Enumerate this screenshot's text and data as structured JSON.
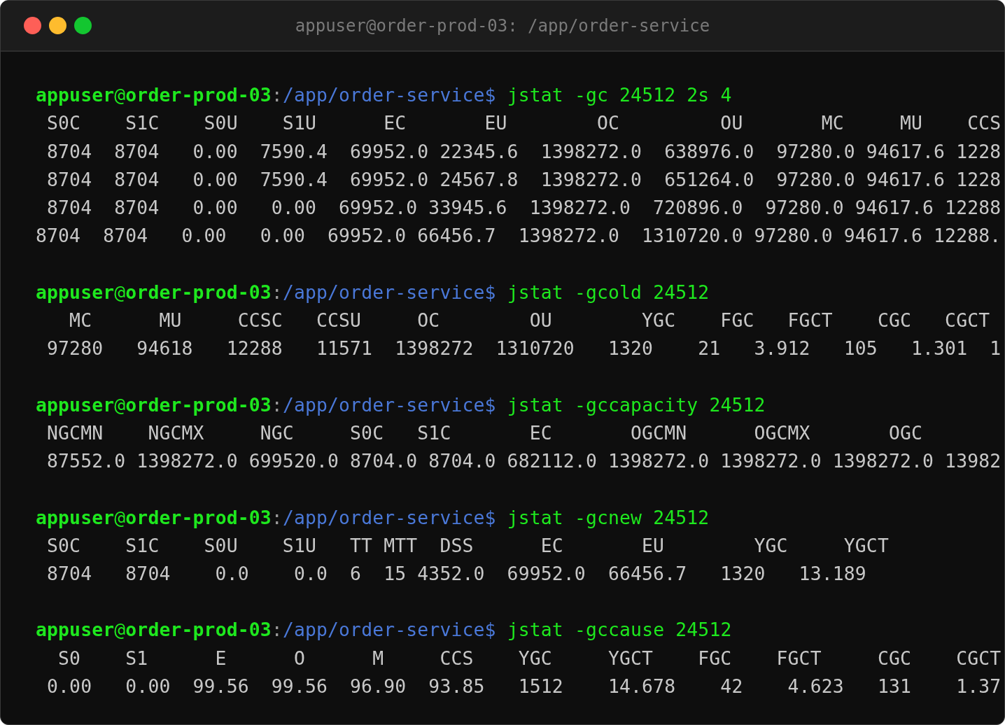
{
  "window": {
    "title": "appuser@order-prod-03: /app/order-service"
  },
  "blocks": [
    {
      "prompt": [
        {
          "kind": "user",
          "text": "appuser"
        },
        {
          "kind": "at",
          "text": "@"
        },
        {
          "kind": "host",
          "text": "order-prod-03"
        },
        {
          "kind": "sep",
          "text": ":"
        },
        {
          "kind": "path",
          "text": "/app/order-service"
        },
        {
          "kind": "dollar",
          "text": "$"
        },
        {
          "kind": "command",
          "text": "jstat -gc 24512 2s 4"
        }
      ],
      "output": [
        " S0C    S1C    S0U    S1U      EC       EU        OC         OU       MC     MU    CCS",
        " 8704  8704   0.00  7590.4  69952.0 22345.6  1398272.0  638976.0  97280.0 94617.6 1228",
        " 8704  8704   0.00  7590.4  69952.0 24567.8  1398272.0  651264.0  97280.0 94617.6 1228",
        " 8704  8704   0.00   0.00  69952.0 33945.6  1398272.0  720896.0  97280.0 94617.6 12288",
        "8704  8704   0.00   0.00  69952.0 66456.7  1398272.0  1310720.0 97280.0 94617.6 12288."
      ]
    },
    {
      "prompt": [
        {
          "kind": "user",
          "text": "appuser"
        },
        {
          "kind": "at",
          "text": "@"
        },
        {
          "kind": "host",
          "text": "order-prod-03"
        },
        {
          "kind": "sep",
          "text": ":"
        },
        {
          "kind": "path",
          "text": "/app/order-service"
        },
        {
          "kind": "dollar",
          "text": "$"
        },
        {
          "kind": "command",
          "text": "jstat -gcold 24512"
        }
      ],
      "output": [
        "   MC      MU     CCSC   CCSU     OC        OU        YGC    FGC   FGCT    CGC   CGCT",
        " 97280   94618   12288   11571  1398272  1310720   1320    21   3.912   105   1.301  1"
      ]
    },
    {
      "prompt": [
        {
          "kind": "user",
          "text": "appuser"
        },
        {
          "kind": "at",
          "text": "@"
        },
        {
          "kind": "host",
          "text": "order-prod-03"
        },
        {
          "kind": "sep",
          "text": ":"
        },
        {
          "kind": "path",
          "text": "/app/order-service"
        },
        {
          "kind": "dollar",
          "text": "$"
        },
        {
          "kind": "command",
          "text": "jstat -gccapacity 24512"
        }
      ],
      "output": [
        " NGCMN    NGCMX     NGC     S0C   S1C       EC       OGCMN      OGCMX       OGC",
        " 87552.0 1398272.0 699520.0 8704.0 8704.0 682112.0 1398272.0 1398272.0 1398272.0 13982"
      ]
    },
    {
      "prompt": [
        {
          "kind": "user",
          "text": "appuser"
        },
        {
          "kind": "at",
          "text": "@"
        },
        {
          "kind": "host",
          "text": "order-prod-03"
        },
        {
          "kind": "sep",
          "text": ":"
        },
        {
          "kind": "path",
          "text": "/app/order-service"
        },
        {
          "kind": "dollar",
          "text": "$"
        },
        {
          "kind": "command",
          "text": "jstat -gcnew 24512"
        }
      ],
      "output": [
        " S0C    S1C    S0U    S1U   TT MTT  DSS      EC       EU        YGC     YGCT",
        " 8704   8704    0.0    0.0  6  15 4352.0  69952.0  66456.7   1320   13.189"
      ]
    },
    {
      "prompt": [
        {
          "kind": "user",
          "text": "appuser"
        },
        {
          "kind": "at",
          "text": "@"
        },
        {
          "kind": "host",
          "text": "order-prod-03"
        },
        {
          "kind": "sep",
          "text": ":"
        },
        {
          "kind": "path",
          "text": "/app/order-service"
        },
        {
          "kind": "dollar",
          "text": "$"
        },
        {
          "kind": "command",
          "text": "jstat -gccause 24512"
        }
      ],
      "output": [
        "  S0    S1      E      O      M     CCS    YGC     YGCT    FGC    FGCT     CGC    CGCT",
        " 0.00   0.00  99.56  99.56  96.90  93.85   1512    14.678    42    4.623   131    1.37"
      ]
    }
  ]
}
